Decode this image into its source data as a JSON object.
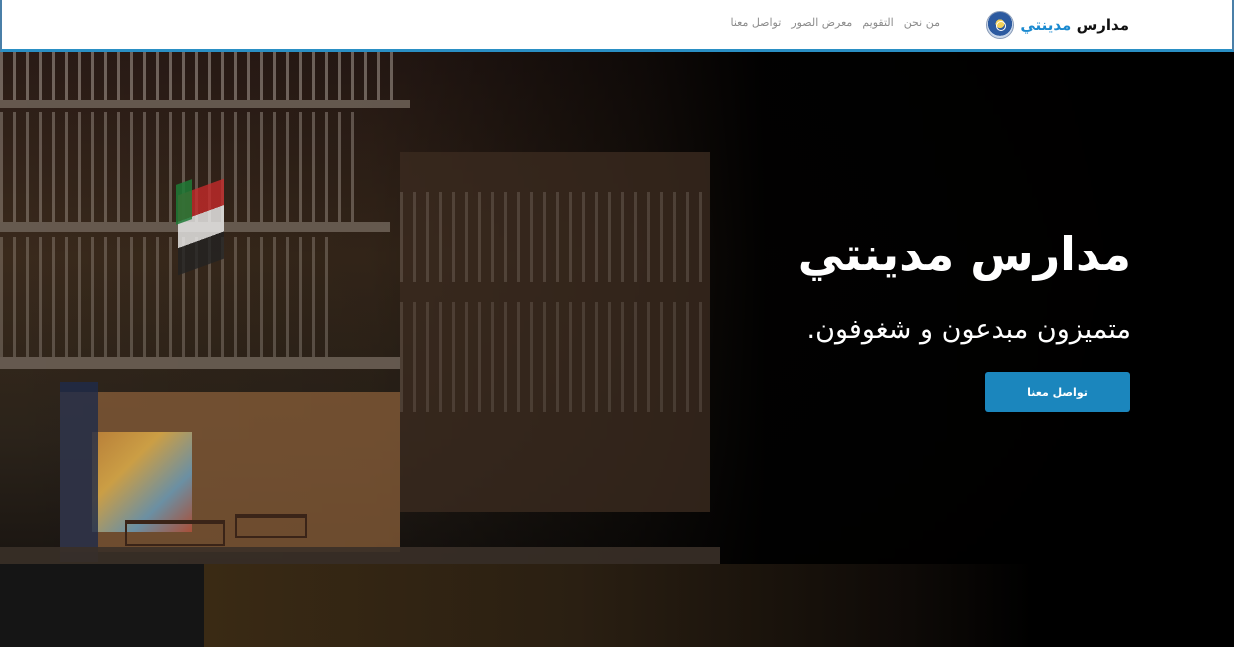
{
  "brand": {
    "name_part1": "مدارس",
    "name_part2": "مدينتي",
    "logo_icon": "school-emblem-icon"
  },
  "nav": {
    "links": [
      {
        "label": "من نحن"
      },
      {
        "label": "التقويم"
      },
      {
        "label": "معرض الصور"
      },
      {
        "label": "تواصل معنا"
      }
    ]
  },
  "hero": {
    "title": "مدارس مدينتي",
    "subtitle": "متميزون مبدعون و شغوفون.",
    "button_label": "تواصل معنا"
  },
  "colors": {
    "accent": "#1b86bd",
    "brand_highlight": "#1b8ad0",
    "nav_link": "#8c8c8c"
  }
}
